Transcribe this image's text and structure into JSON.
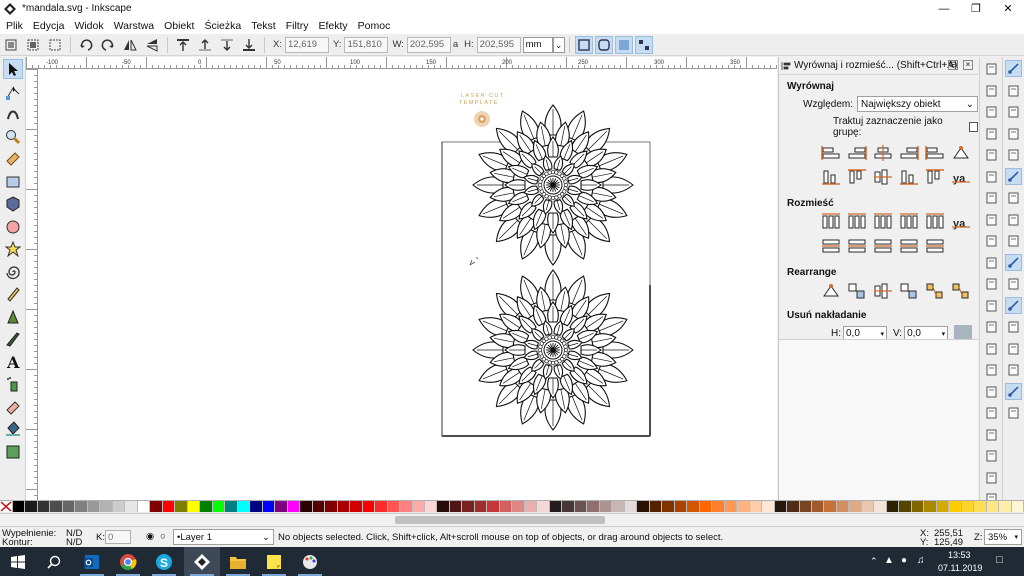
{
  "window": {
    "title": "*mandala.svg - Inkscape"
  },
  "menu": [
    "Plik",
    "Edycja",
    "Widok",
    "Warstwa",
    "Obiekt",
    "Ścieżka",
    "Tekst",
    "Filtry",
    "Efekty",
    "Pomoc"
  ],
  "toolbar": {
    "x_label": "X:",
    "x_value": "12,619",
    "y_label": "Y:",
    "y_value": "151,810",
    "w_label": "W:",
    "w_value": "202,595",
    "h_label": "H:",
    "h_value": "202,595",
    "unit": "mm"
  },
  "ruler_labels": [
    "-100",
    "-50",
    "0",
    "50",
    "100",
    "150",
    "200",
    "250",
    "300",
    "350"
  ],
  "canvas": {
    "watermark_line1": "LASER CUT",
    "watermark_line2": "TEMPLATE"
  },
  "panel": {
    "title": "Wyrównaj i rozmieść... (Shift+Ctrl+A)",
    "align_heading": "Wyrównaj",
    "relative_label": "Względem:",
    "relative_value": "Największy obiekt",
    "group_checkbox_label": "Traktuj zaznaczenie jako grupę:",
    "distribute_heading": "Rozmieść",
    "rearrange_heading": "Rearrange",
    "overlap_heading": "Usuń nakładanie",
    "h_label": "H:",
    "h_value": "0,0",
    "v_label": "V:",
    "v_value": "0,0"
  },
  "status": {
    "fill_label": "Wypełnienie:",
    "fill_value": "N/D",
    "stroke_label": "Kontur:",
    "stroke_value": "N/D",
    "opacity_label": "K:",
    "opacity_value": "0",
    "layer": "•Layer 1",
    "message": "No objects selected. Click, Shift+click, Alt+scroll mouse on top of objects, or drag around objects to select.",
    "cursor_x_label": "X:",
    "cursor_x": "255,51",
    "cursor_y_label": "Y:",
    "cursor_y": "125,49",
    "zoom_label": "Z:",
    "zoom": "35%"
  },
  "clock": {
    "time": "13:53",
    "date": "07.11.2019"
  },
  "palette": [
    "#000000",
    "#1a1a1a",
    "#333333",
    "#4d4d4d",
    "#666666",
    "#808080",
    "#999999",
    "#b3b3b3",
    "#cccccc",
    "#e6e6e6",
    "#ffffff",
    "#800000",
    "#ff0000",
    "#808000",
    "#ffff00",
    "#008000",
    "#00ff00",
    "#008080",
    "#00ffff",
    "#000080",
    "#0000ff",
    "#800080",
    "#ff00ff",
    "#2b0000",
    "#550000",
    "#800000",
    "#aa0000",
    "#d40000",
    "#ff0000",
    "#ff2a2a",
    "#ff5555",
    "#ff8080",
    "#ffaaaa",
    "#ffd5d5",
    "#280b0b",
    "#501616",
    "#782121",
    "#a02c2c",
    "#c83737",
    "#d35f5f",
    "#de8787",
    "#e9afaf",
    "#f4d7d7",
    "#241c1c",
    "#483737",
    "#6c5353",
    "#916f6f",
    "#ac9393",
    "#c8b7b7",
    "#e3dbdb",
    "#2b1100",
    "#552200",
    "#803300",
    "#aa4400",
    "#d45500",
    "#ff6600",
    "#ff7f2a",
    "#ff9955",
    "#ffb380",
    "#ffccaa",
    "#ffe6d5",
    "#28170b",
    "#502d16",
    "#784421",
    "#a05a2c",
    "#c87137",
    "#d38d5f",
    "#deaa87",
    "#e9c6af",
    "#f4e3d7",
    "#2b2200",
    "#554400",
    "#806600",
    "#aa8800",
    "#d4aa00",
    "#ffcc00",
    "#ffd42a",
    "#ffdd55",
    "#ffe680",
    "#ffeeaa",
    "#fff6d5"
  ]
}
